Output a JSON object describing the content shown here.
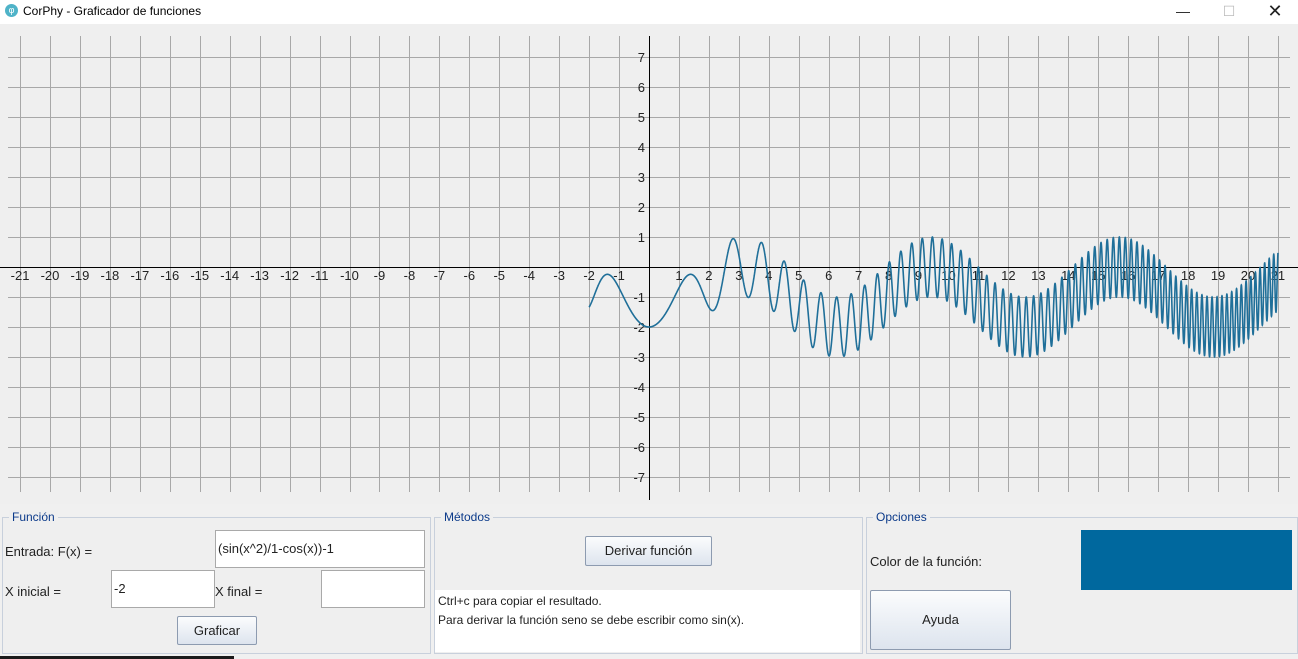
{
  "window": {
    "title": "CorPhy - Graficador de funciones",
    "icon": "φ",
    "minimize": "—",
    "maximize": "☐",
    "close": "✕"
  },
  "chart_data": {
    "type": "line",
    "series": [
      {
        "expression": "(sin(x^2)/1-cos(x))-1",
        "color": "#1f6f99"
      }
    ],
    "x_range": [
      -2,
      21
    ],
    "view_xlim": [
      -22,
      21
    ],
    "view_ylim": [
      -7,
      7
    ],
    "x_ticks": [
      "-21",
      "-20",
      "-19",
      "-18",
      "-17",
      "-16",
      "-15",
      "-14",
      "-13",
      "-12",
      "-11",
      "-10",
      "-9",
      "-8",
      "-7",
      "-6",
      "-5",
      "-4",
      "-3",
      "-2",
      "-1",
      "1",
      "2",
      "3",
      "4",
      "5",
      "6",
      "7",
      "8",
      "9",
      "10",
      "11",
      "12",
      "13",
      "14",
      "15",
      "16",
      "17",
      "18",
      "19",
      "20",
      "21"
    ],
    "y_ticks": [
      "7",
      "6",
      "5",
      "4",
      "3",
      "2",
      "1",
      "-1",
      "-2",
      "-3",
      "-4",
      "-5",
      "-6",
      "-7"
    ],
    "grid": true
  },
  "funcion": {
    "title": "Función",
    "entrada_label": "Entrada: F(x) =",
    "entrada_value": "(sin(x^2)/1-cos(x))-1",
    "xinicial_label": "X inicial =",
    "xinicial_value": "-2",
    "xfinal_label": "X final =",
    "xfinal_value": "",
    "graficar_button": "Graficar"
  },
  "metodos": {
    "title": "Métodos",
    "derivar_button": "Derivar función",
    "info_line1": "Ctrl+c para copiar el resultado.",
    "info_line2": "Para derivar la función seno se debe escribir como sin(x)."
  },
  "opciones": {
    "title": "Opciones",
    "color_label": "Color de la función:",
    "color_value": "#00689e",
    "ayuda_button": "Ayuda"
  }
}
